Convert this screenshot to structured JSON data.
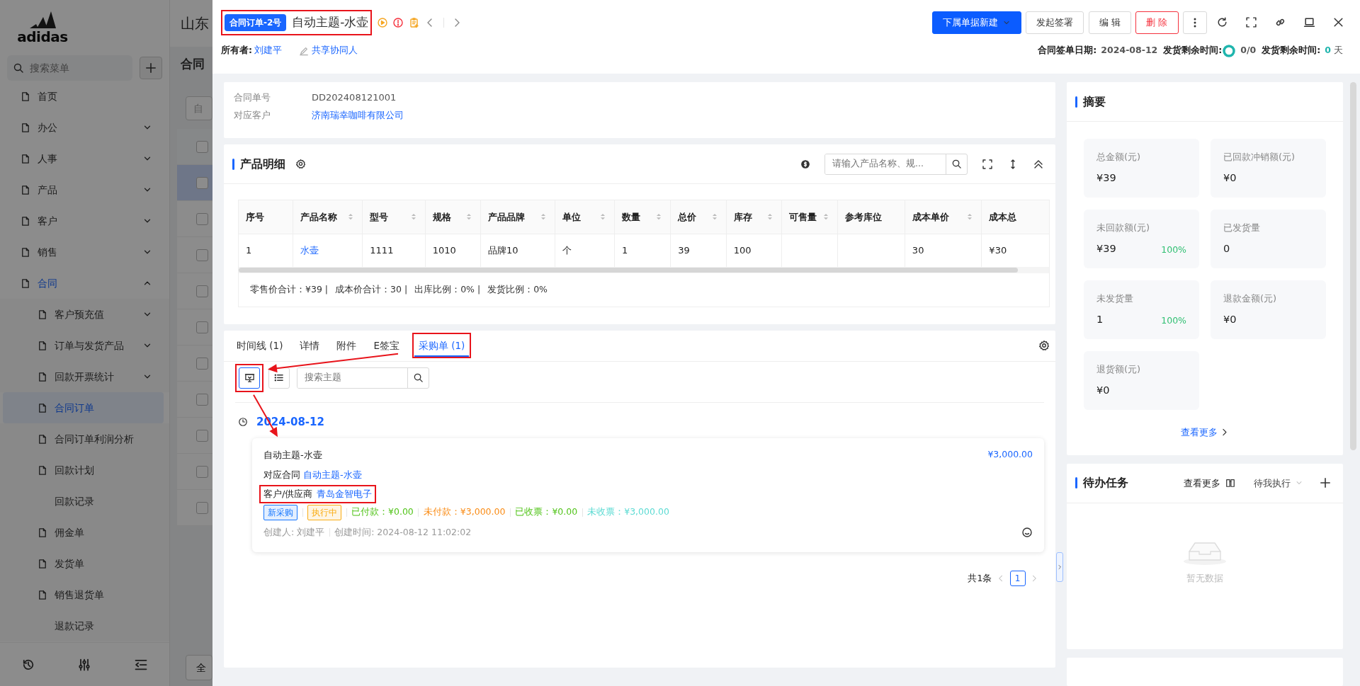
{
  "background_app": {
    "logo": "adidas",
    "search": {
      "placeholder": "搜索菜单"
    },
    "menu": [
      {
        "label": "首页",
        "kind": "link",
        "selected": false
      },
      {
        "label": "办公",
        "kind": "group",
        "expanded": false
      },
      {
        "label": "人事",
        "kind": "group",
        "expanded": false
      },
      {
        "label": "产品",
        "kind": "group",
        "expanded": false
      },
      {
        "label": "客户",
        "kind": "group",
        "expanded": false
      },
      {
        "label": "销售",
        "kind": "group",
        "expanded": false
      },
      {
        "label": "合同",
        "kind": "group",
        "expanded": true,
        "children": [
          {
            "label": "客户预充值",
            "kind": "group",
            "expanded": false
          },
          {
            "label": "订单与发货产品",
            "kind": "group",
            "expanded": false
          },
          {
            "label": "回款开票统计",
            "kind": "group",
            "expanded": false
          },
          {
            "label": "合同订单",
            "kind": "link",
            "selected": true
          },
          {
            "label": "合同订单利润分析",
            "kind": "link",
            "selected": false
          },
          {
            "label": "回款计划",
            "kind": "link",
            "selected": false
          },
          {
            "label": "回款记录",
            "kind": "plain",
            "selected": false
          },
          {
            "label": "佣金单",
            "kind": "link",
            "selected": false
          },
          {
            "label": "发货单",
            "kind": "link",
            "selected": false
          },
          {
            "label": "销售退货单",
            "kind": "link",
            "selected": false
          },
          {
            "label": "退款记录",
            "kind": "plain",
            "selected": false
          }
        ]
      }
    ],
    "page_title": "山东",
    "page_tab": "合同",
    "filter_text": "自",
    "footer_button": "全",
    "header_checkbox": {
      "checked": false
    },
    "rows": [
      {
        "checked": false,
        "selected": true
      },
      {
        "checked": false,
        "selected": false
      },
      {
        "checked": false,
        "selected": false
      },
      {
        "checked": false,
        "selected": false
      },
      {
        "checked": false,
        "selected": false
      },
      {
        "checked": false,
        "selected": false
      },
      {
        "checked": false,
        "selected": false
      },
      {
        "checked": false,
        "selected": false
      },
      {
        "checked": false,
        "selected": false
      },
      {
        "checked": false,
        "selected": false
      }
    ]
  },
  "drawer": {
    "header": {
      "badge": "合同订单-2号",
      "title": "自动主题-水壶",
      "highlighted": true,
      "owner_label": "所有者:",
      "owner": "刘建平",
      "share": "共享协同人",
      "actions": [
        {
          "label": "下属单据新建",
          "kind": "primary"
        },
        {
          "label": "发起签署",
          "kind": "default"
        },
        {
          "label": "编 辑",
          "kind": "default"
        },
        {
          "label": "删 除",
          "kind": "danger"
        }
      ],
      "meta": [
        {
          "label": "合同签单日期:",
          "value": "2024-08-12",
          "kind": "text"
        },
        {
          "label": "发货剩余时间:",
          "value": "0/0",
          "kind": "ring"
        },
        {
          "label": "发货剩余时间:",
          "value": "0",
          "unit": "天",
          "kind": "days"
        }
      ]
    },
    "info": [
      {
        "label": "合同单号",
        "value": "DD202408121001",
        "kind": "text"
      },
      {
        "label": "对应客户",
        "value": "济南瑞幸咖啡有限公司",
        "kind": "link"
      }
    ],
    "products": {
      "title": "产品明细",
      "search": {
        "placeholder": "请输入产品名称、规..."
      },
      "columns": [
        {
          "label": "序号",
          "sortable": false
        },
        {
          "label": "产品名称",
          "sortable": true
        },
        {
          "label": "型号",
          "sortable": true
        },
        {
          "label": "规格",
          "sortable": true
        },
        {
          "label": "产品品牌",
          "sortable": true
        },
        {
          "label": "单位",
          "sortable": true
        },
        {
          "label": "数量",
          "sortable": true
        },
        {
          "label": "总价",
          "sortable": true
        },
        {
          "label": "库存",
          "sortable": true
        },
        {
          "label": "可售量",
          "sortable": true
        },
        {
          "label": "参考库位",
          "sortable": false
        },
        {
          "label": "成本单价",
          "sortable": true
        },
        {
          "label": "成本总",
          "sortable": false
        }
      ],
      "rows": [
        [
          "1",
          {
            "link": "水壶"
          },
          "1111",
          "1010",
          "品牌10",
          "个",
          "1",
          "39",
          "100",
          null,
          null,
          "30",
          "¥30"
        ]
      ],
      "totals": [
        "零售价合计：¥39 |",
        "成本价合计：30 |",
        "出库比例：0% |",
        "发货比例：0%"
      ]
    },
    "tabs": [
      {
        "label": "时间线 (1)",
        "selected": false,
        "highlighted": false
      },
      {
        "label": "详情",
        "selected": false,
        "highlighted": false
      },
      {
        "label": "附件",
        "selected": false,
        "highlighted": false
      },
      {
        "label": "E签宝",
        "selected": false,
        "highlighted": false
      },
      {
        "label": "采购单 (1)",
        "selected": true,
        "highlighted": true
      }
    ],
    "views": [
      {
        "kind": "card",
        "selected": true,
        "highlighted": true
      },
      {
        "kind": "list",
        "selected": false,
        "highlighted": false
      }
    ],
    "search": {
      "placeholder": "搜索主题"
    },
    "timeline": [
      {
        "date": "2024-08-12",
        "entries": [
          {
            "title": "自动主题-水壶",
            "amount": "¥3,000.00",
            "contract_label": "对应合同",
            "contract": "自动主题-水壶",
            "party_label": "客户/供应商",
            "party": "青岛金智电子",
            "party_highlighted": true,
            "tags": [
              {
                "text": "新采购",
                "color": "#1677ff"
              },
              {
                "text": "执行中",
                "color": "#faad14"
              }
            ],
            "stats": [
              {
                "text": "已付款：¥0.00",
                "color": "#52c41a"
              },
              {
                "text": "未付款：¥3,000.00",
                "color": "#fa8c16"
              },
              {
                "text": "已收票：¥0.00",
                "color": "#52c41a"
              },
              {
                "text": "未收票：¥3,000.00",
                "color": "#5cdbd3"
              }
            ],
            "creator": "创建人: 刘建平",
            "created": "创建时间: 2024-08-12 11:02:02"
          }
        ]
      }
    ],
    "pagination": {
      "total": "共1条",
      "pages": [
        {
          "label": "1",
          "selected": true
        }
      ]
    },
    "summary": {
      "title": "摘要",
      "tiles": [
        {
          "label": "总金额(元)",
          "value": "¥39"
        },
        {
          "label": "已回款冲销额(元)",
          "value": "¥0"
        },
        {
          "label": "未回款额(元)",
          "value": "¥39",
          "percent": "100%"
        },
        {
          "label": "已发货量",
          "value": "0"
        },
        {
          "label": "未发货量",
          "value": "1",
          "percent": "100%"
        },
        {
          "label": "退款金额(元)",
          "value": "¥0"
        },
        {
          "label": "退货额(元)",
          "value": "¥0"
        }
      ],
      "more": "查看更多"
    },
    "tasks": {
      "title": "待办任务",
      "more": "查看更多",
      "filter": "待我执行",
      "empty": "暂无数据"
    }
  }
}
